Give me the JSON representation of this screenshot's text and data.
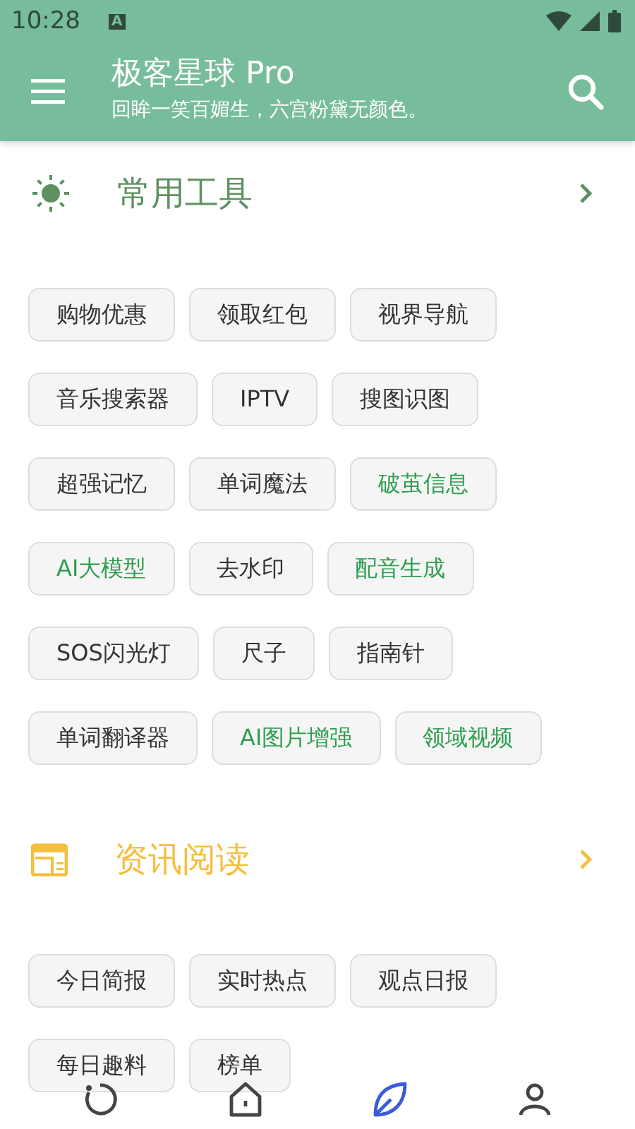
{
  "status_bar": {
    "time": "10:28",
    "badge": "A"
  },
  "toolbar": {
    "title": "极客星球 Pro",
    "subtitle": "回眸一笑百媚生，六宫粉黛无颜色。"
  },
  "sections": [
    {
      "kind": "tools",
      "title": "常用工具",
      "color": "#5e9160",
      "chips": [
        {
          "label": "购物优惠",
          "highlighted": false
        },
        {
          "label": "领取红包",
          "highlighted": false
        },
        {
          "label": "视界导航",
          "highlighted": false
        },
        {
          "label": "音乐搜索器",
          "highlighted": false
        },
        {
          "label": "IPTV",
          "highlighted": false
        },
        {
          "label": "搜图识图",
          "highlighted": false
        },
        {
          "label": "超强记忆",
          "highlighted": false
        },
        {
          "label": "单词魔法",
          "highlighted": false
        },
        {
          "label": "破茧信息",
          "highlighted": true
        },
        {
          "label": "AI大模型",
          "highlighted": true
        },
        {
          "label": "去水印",
          "highlighted": false
        },
        {
          "label": "配音生成",
          "highlighted": true
        },
        {
          "label": "SOS闪光灯",
          "highlighted": false
        },
        {
          "label": "尺子",
          "highlighted": false
        },
        {
          "label": "指南针",
          "highlighted": false
        },
        {
          "label": "单词翻译器",
          "highlighted": false
        },
        {
          "label": "AI图片增强",
          "highlighted": true
        },
        {
          "label": "领域视频",
          "highlighted": true
        }
      ]
    },
    {
      "kind": "news",
      "title": "资讯阅读",
      "color": "#f5bf3e",
      "chips": [
        {
          "label": "今日简报",
          "highlighted": false
        },
        {
          "label": "实时热点",
          "highlighted": false
        },
        {
          "label": "观点日报",
          "highlighted": false
        },
        {
          "label": "每日趣料",
          "highlighted": false
        },
        {
          "label": "榜单",
          "highlighted": false
        }
      ]
    }
  ],
  "bottom_nav": [
    {
      "kind": "refresh",
      "selected": false
    },
    {
      "kind": "home",
      "selected": false
    },
    {
      "kind": "leaf",
      "selected": true
    },
    {
      "kind": "profile",
      "selected": false
    }
  ]
}
